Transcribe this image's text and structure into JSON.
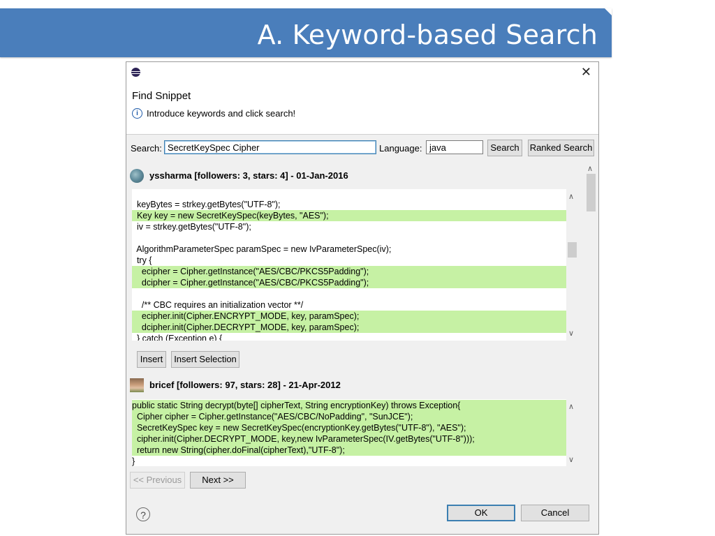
{
  "slide": {
    "title": "A.  Keyword-based Search"
  },
  "dialog": {
    "title": "Find Snippet",
    "info_text": "Introduce keywords and click search!",
    "close_glyph": "✕",
    "search_label": "Search:",
    "search_value": "SecretKeySpec Cipher",
    "language_label": "Language:",
    "language_value": "java",
    "search_button": "Search",
    "ranked_search_button": "Ranked Search",
    "insert_button": "Insert",
    "insert_selection_button": "Insert Selection",
    "previous_button": "<< Previous",
    "next_button": "Next >>",
    "ok_button": "OK",
    "cancel_button": "Cancel",
    "help_glyph": "?"
  },
  "results": [
    {
      "user": "yssharma  [followers: 3, stars: 4] - 01-Jan-2016",
      "lines": [
        {
          "text": "",
          "highlighted": false
        },
        {
          "text": "  keyBytes = strkey.getBytes(\"UTF-8\");",
          "highlighted": false
        },
        {
          "text": "  Key key = new SecretKeySpec(keyBytes, \"AES\");",
          "highlighted": true
        },
        {
          "text": "  iv = strkey.getBytes(\"UTF-8\");",
          "highlighted": false
        },
        {
          "text": "",
          "highlighted": false
        },
        {
          "text": "  AlgorithmParameterSpec paramSpec = new IvParameterSpec(iv);",
          "highlighted": false
        },
        {
          "text": "  try {",
          "highlighted": false
        },
        {
          "text": "    ecipher = Cipher.getInstance(\"AES/CBC/PKCS5Padding\");",
          "highlighted": true
        },
        {
          "text": "    dcipher = Cipher.getInstance(\"AES/CBC/PKCS5Padding\");",
          "highlighted": true
        },
        {
          "text": "",
          "highlighted": false
        },
        {
          "text": "    /** CBC requires an initialization vector **/",
          "highlighted": false
        },
        {
          "text": "    ecipher.init(Cipher.ENCRYPT_MODE, key, paramSpec);",
          "highlighted": true
        },
        {
          "text": "    dcipher.init(Cipher.DECRYPT_MODE, key, paramSpec);",
          "highlighted": true
        },
        {
          "text": "  } catch (Exception e) {",
          "highlighted": false
        }
      ]
    },
    {
      "user": "bricef  [followers: 97, stars: 28] - 21-Apr-2012",
      "lines": [
        {
          "text": "public static String decrypt(byte[] cipherText, String encryptionKey) throws Exception{",
          "highlighted": true
        },
        {
          "text": "  Cipher cipher = Cipher.getInstance(\"AES/CBC/NoPadding\", \"SunJCE\");",
          "highlighted": true
        },
        {
          "text": "  SecretKeySpec key = new SecretKeySpec(encryptionKey.getBytes(\"UTF-8\"), \"AES\");",
          "highlighted": true
        },
        {
          "text": "  cipher.init(Cipher.DECRYPT_MODE, key,new IvParameterSpec(IV.getBytes(\"UTF-8\")));",
          "highlighted": true
        },
        {
          "text": "  return new String(cipher.doFinal(cipherText),\"UTF-8\");",
          "highlighted": true
        },
        {
          "text": "}",
          "highlighted": false
        }
      ]
    }
  ],
  "icons": {
    "app": "eclipse-icon",
    "info": "info-icon",
    "help": "help-icon",
    "scroll_up": "chevron-up-icon",
    "scroll_down": "chevron-down-icon"
  },
  "colors": {
    "banner": "#4a7ebb",
    "highlight": "#c6f1a4",
    "dialog_bg": "#f0f0f0"
  }
}
